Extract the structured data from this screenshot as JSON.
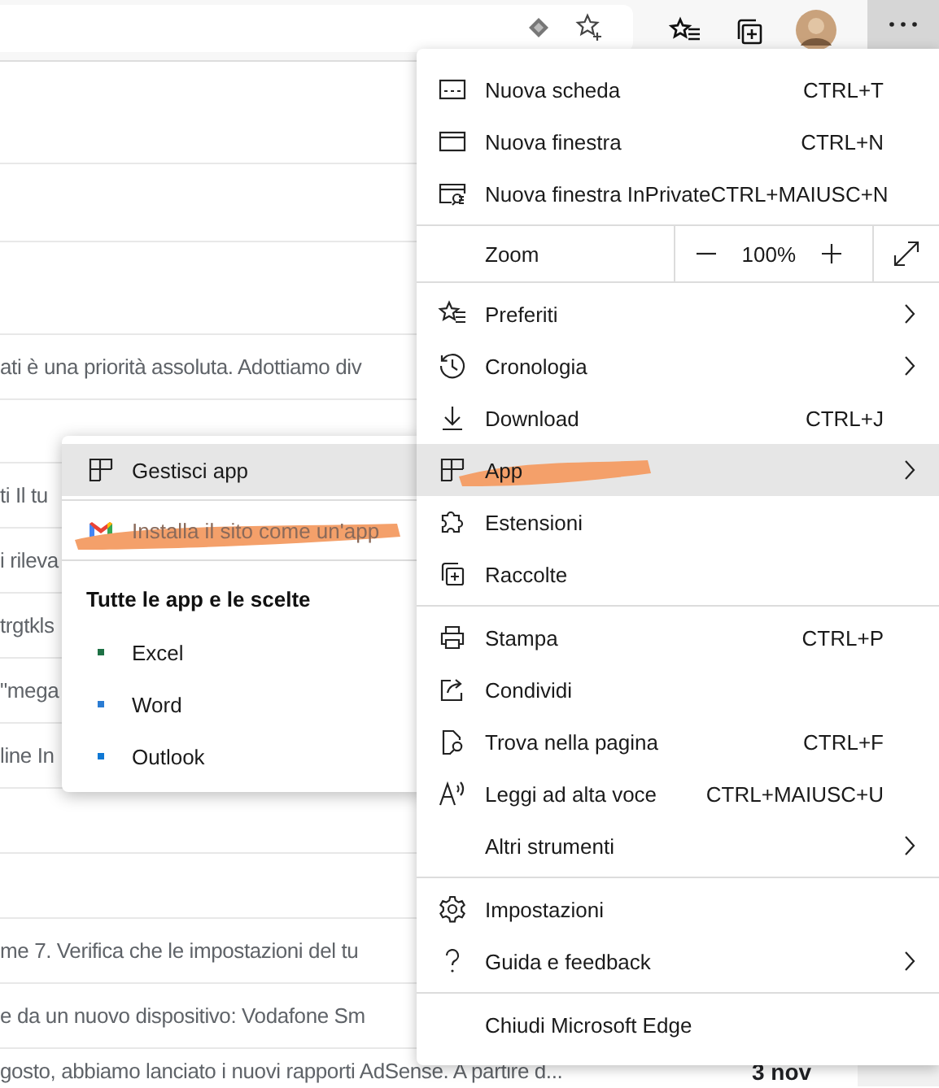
{
  "toolbar": {
    "menu_button": {
      "selected": true
    }
  },
  "mail_rows": [
    {
      "text": "ati è una priorità assoluta. Adottiamo div"
    },
    {
      "text": "ti Il tu"
    },
    {
      "text": "i rileva"
    },
    {
      "text": "trgtkls"
    },
    {
      "text": "\"mega"
    },
    {
      "text": "line In"
    },
    {
      "text": "me 7. Verifica che le impostazioni del tu"
    },
    {
      "text": "e da un nuovo dispositivo: Vodafone Sm"
    },
    {
      "text": "gosto, abbiamo lanciato i nuovi rapporti AdSense. A partire d...",
      "date": "3 nov"
    }
  ],
  "menu": {
    "sections": [
      [
        {
          "kind": "item",
          "label": "Nuova scheda",
          "shortcut": "CTRL+T",
          "selected": false
        },
        {
          "kind": "item",
          "label": "Nuova finestra",
          "shortcut": "CTRL+N",
          "selected": false
        },
        {
          "kind": "item",
          "label": "Nuova finestra InPrivate",
          "shortcut": "CTRL+MAIUSC+N",
          "selected": false
        }
      ],
      [
        {
          "kind": "zoom",
          "label": "Zoom",
          "value": "100%"
        }
      ],
      [
        {
          "kind": "item",
          "label": "Preferiti",
          "submenu": true,
          "selected": false
        },
        {
          "kind": "item",
          "label": "Cronologia",
          "submenu": true,
          "selected": false
        },
        {
          "kind": "item",
          "label": "Download",
          "shortcut": "CTRL+J",
          "selected": false
        },
        {
          "kind": "item",
          "label": "App",
          "submenu": true,
          "selected": true,
          "scribbled": true
        },
        {
          "kind": "item",
          "label": "Estensioni",
          "selected": false
        },
        {
          "kind": "item",
          "label": "Raccolte",
          "selected": false
        }
      ],
      [
        {
          "kind": "item",
          "label": "Stampa",
          "shortcut": "CTRL+P",
          "selected": false
        },
        {
          "kind": "item",
          "label": "Condividi",
          "selected": false
        },
        {
          "kind": "item",
          "label": "Trova nella pagina",
          "shortcut": "CTRL+F",
          "selected": false
        },
        {
          "kind": "item",
          "label": "Leggi ad alta voce",
          "shortcut": "CTRL+MAIUSC+U",
          "selected": false
        },
        {
          "kind": "item",
          "label": "Altri strumenti",
          "submenu": true,
          "selected": false
        }
      ],
      [
        {
          "kind": "item",
          "label": "Impostazioni",
          "selected": false
        },
        {
          "kind": "item",
          "label": "Guida e feedback",
          "submenu": true,
          "selected": false
        }
      ],
      [
        {
          "kind": "item",
          "label": "Chiudi Microsoft Edge",
          "selected": false
        }
      ]
    ]
  },
  "apps_submenu": {
    "sections": [
      [
        {
          "kind": "action",
          "label": "Gestisci app",
          "selected": true
        }
      ],
      [
        {
          "kind": "action",
          "label": "Installa il sito come un'app",
          "selected": false,
          "scribbled": true
        }
      ],
      [
        {
          "kind": "header",
          "label": "Tutte le app e le scelte"
        },
        {
          "kind": "app",
          "label": "Excel",
          "color": "#1e7145",
          "selected": false
        },
        {
          "kind": "app",
          "label": "Word",
          "color": "#2b7cd3",
          "selected": false
        },
        {
          "kind": "app",
          "label": "Outlook",
          "color": "#0f78d4",
          "selected": false
        }
      ]
    ]
  }
}
